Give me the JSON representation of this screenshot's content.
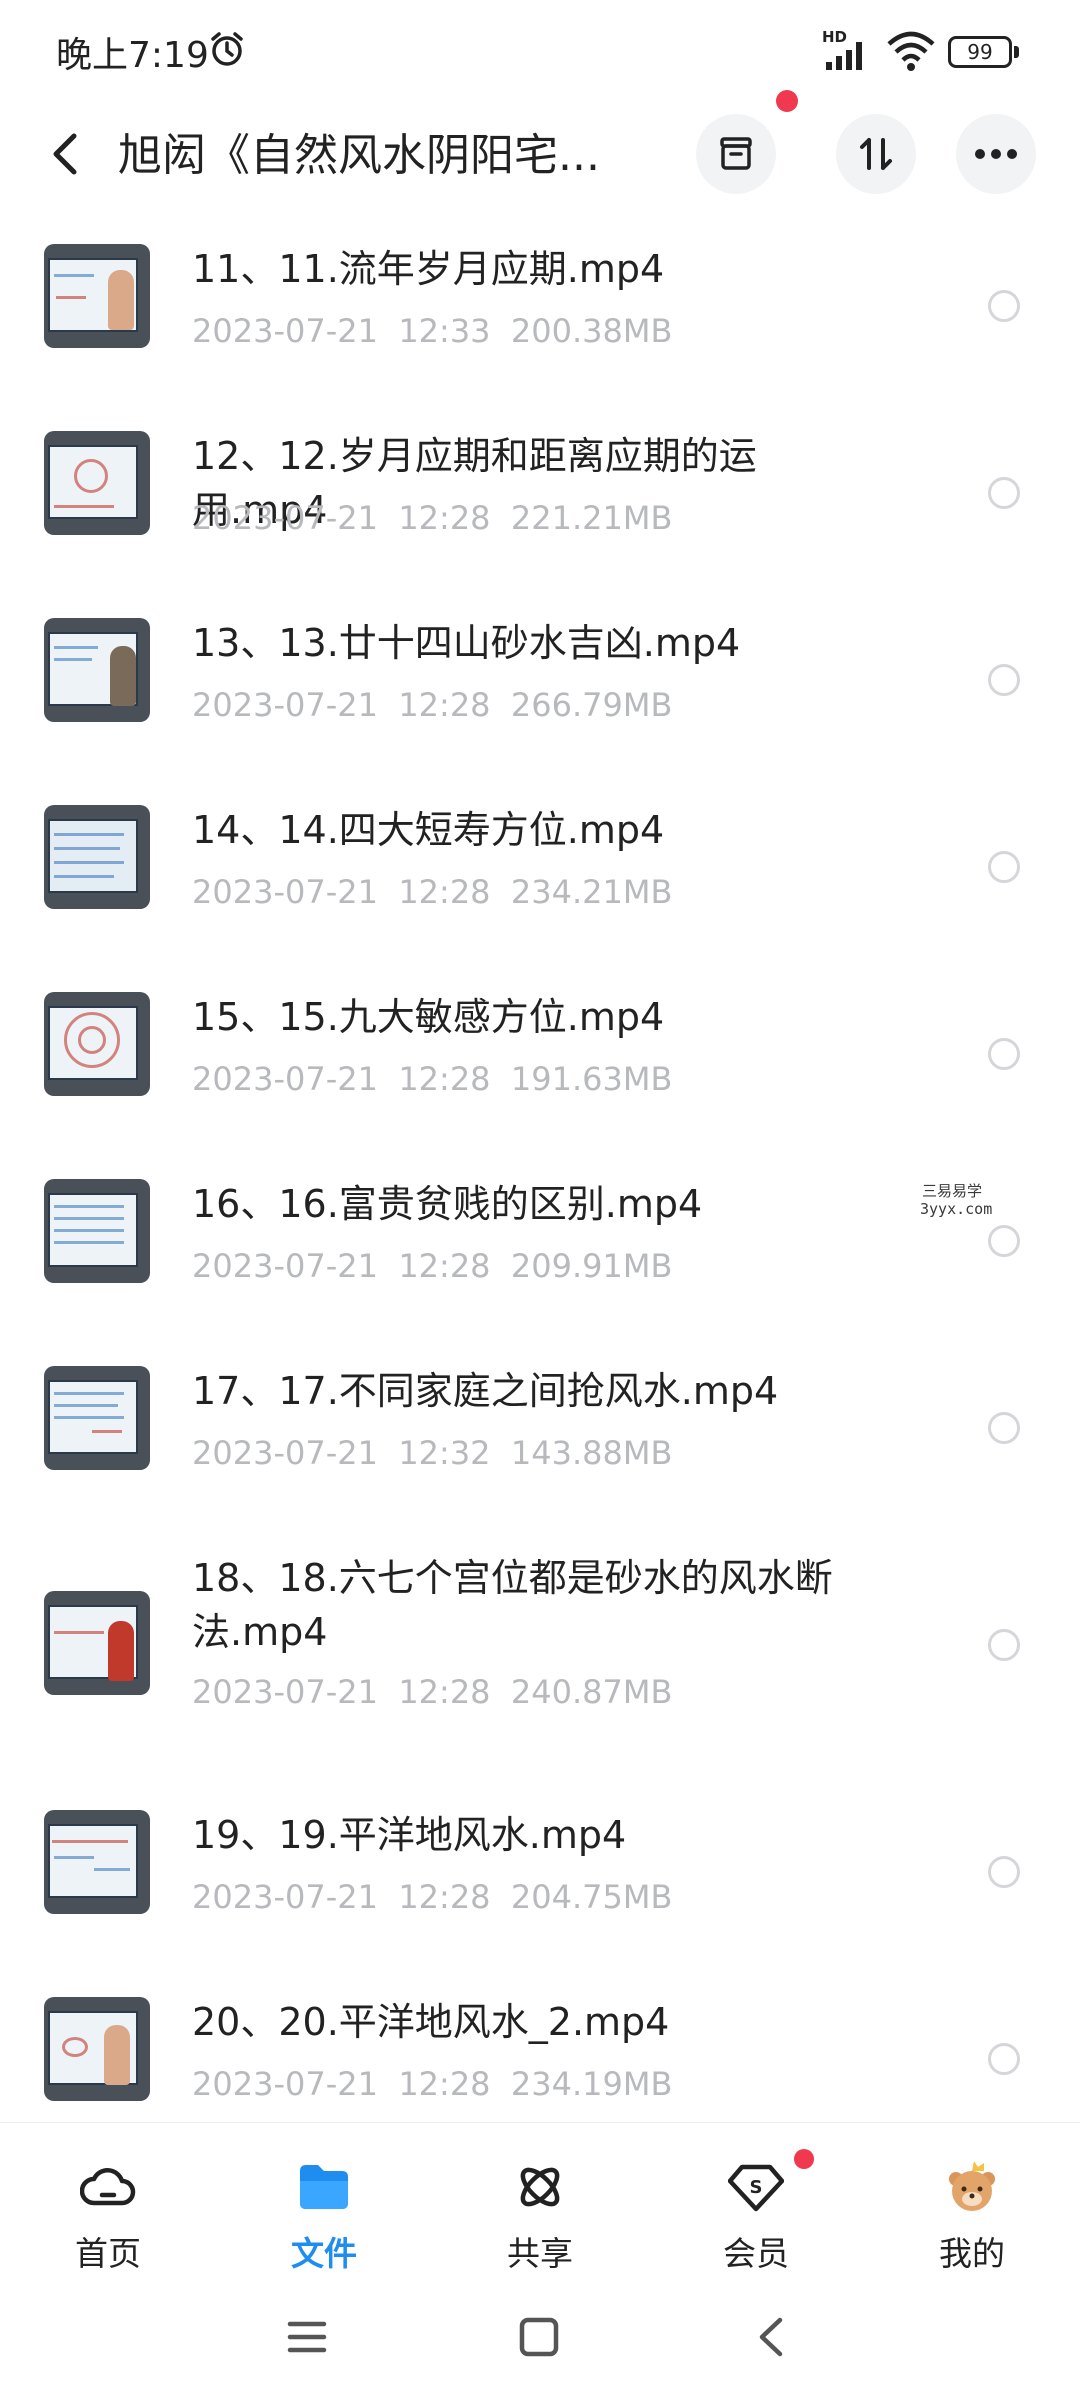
{
  "status_bar": {
    "time": "晚上7:19",
    "network": "HD",
    "battery": "99"
  },
  "header": {
    "title": "旭闳《自然风水阴阳宅...",
    "back_icon": "chevron-left-icon",
    "buttons": [
      "archive-icon",
      "sort-icon",
      "more-icon"
    ]
  },
  "files": [
    {
      "name": "11、11.流年岁月应期.mp4",
      "meta": "2023-07-21  12:33  200.38MB"
    },
    {
      "name": "12、12.岁月应期和距离应期的运用.mp4",
      "meta": "2023-07-21  12:28  221.21MB"
    },
    {
      "name": "13、13.廿十四山砂水吉凶.mp4",
      "meta": "2023-07-21  12:28  266.79MB"
    },
    {
      "name": "14、14.四大短寿方位.mp4",
      "meta": "2023-07-21  12:28  234.21MB"
    },
    {
      "name": "15、15.九大敏感方位.mp4",
      "meta": "2023-07-21  12:28  191.63MB"
    },
    {
      "name": "16、16.富贵贫贱的区别.mp4",
      "meta": "2023-07-21  12:28  209.91MB"
    },
    {
      "name": "17、17.不同家庭之间抢风水.mp4",
      "meta": "2023-07-21  12:32  143.88MB"
    },
    {
      "name": "18、18.六七个宫位都是砂水的风水断法.mp4",
      "meta": "2023-07-21  12:28  240.87MB"
    },
    {
      "name": "19、19.平洋地风水.mp4",
      "meta": "2023-07-21  12:28  204.75MB"
    },
    {
      "name": "20、20.平洋地风水_2.mp4",
      "meta": "2023-07-21  12:28  234.19MB"
    }
  ],
  "watermark": {
    "text": "三易易学",
    "url": "3yyx.com"
  },
  "bottom_nav": {
    "items": [
      {
        "label": "首页",
        "icon": "cloud-icon"
      },
      {
        "label": "文件",
        "icon": "folder-icon",
        "active": true
      },
      {
        "label": "共享",
        "icon": "share-atom-icon"
      },
      {
        "label": "会员",
        "icon": "member-badge-icon"
      },
      {
        "label": "我的",
        "icon": "bear-avatar-icon"
      }
    ]
  },
  "colors": {
    "accent": "#1f8cf0",
    "notification": "#f0384f",
    "meta_text": "#b7b9bd"
  }
}
